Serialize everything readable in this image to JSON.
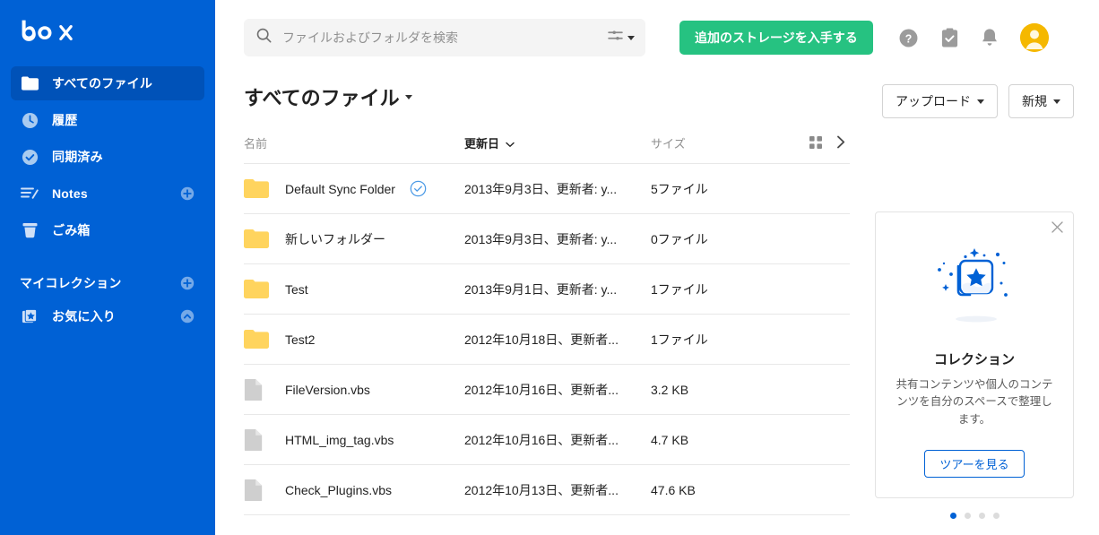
{
  "sidebar": {
    "logo_text": "box",
    "items": [
      {
        "label": "すべてのファイル",
        "icon": "folder-icon",
        "active": true
      },
      {
        "label": "履歴",
        "icon": "clock-icon",
        "active": false
      },
      {
        "label": "同期済み",
        "icon": "check-circle-icon",
        "active": false
      },
      {
        "label": "Notes",
        "icon": "notes-icon",
        "active": false,
        "trailing": "plus-icon"
      },
      {
        "label": "ごみ箱",
        "icon": "trash-icon",
        "active": false
      }
    ],
    "collections": {
      "header": "マイコレクション",
      "header_trailing": "plus-icon",
      "items": [
        {
          "label": "お気に入り",
          "icon": "favorites-star-icon",
          "trailing": "chevron-up-icon"
        }
      ]
    }
  },
  "topbar": {
    "search": {
      "placeholder": "ファイルおよびフォルダを検索",
      "value": "",
      "icon": "search-icon",
      "filter_icon": "filter-icon"
    },
    "cta_label": "追加のストレージを入手する",
    "icons": [
      {
        "name": "help-icon"
      },
      {
        "name": "tasks-clipboard-icon"
      },
      {
        "name": "notifications-bell-icon"
      }
    ],
    "avatar": {
      "name": "user-avatar",
      "color": "#f5b800"
    }
  },
  "buttons": {
    "upload_label": "アップロード",
    "new_label": "新規"
  },
  "main": {
    "page_title": "すべてのファイル",
    "columns": {
      "name": "名前",
      "date": "更新日",
      "size": "サイズ",
      "grid_icon": "grid-view-icon",
      "expand_icon": "chevron-right-icon"
    },
    "rows": [
      {
        "icon": "folder-icon",
        "name": "Default Sync Folder",
        "badge": "sync-check-icon",
        "date": "2013年9月3日、更新者: y...",
        "size": "5ファイル"
      },
      {
        "icon": "folder-icon",
        "name": "新しいフォルダー",
        "badge": null,
        "date": "2013年9月3日、更新者: y...",
        "size": "0ファイル"
      },
      {
        "icon": "folder-icon",
        "name": "Test",
        "badge": null,
        "date": "2013年9月1日、更新者: y...",
        "size": "1ファイル"
      },
      {
        "icon": "folder-icon",
        "name": "Test2",
        "badge": null,
        "date": "2012年10月18日、更新者...",
        "size": "1ファイル"
      },
      {
        "icon": "file-icon",
        "name": "FileVersion.vbs",
        "badge": null,
        "date": "2012年10月16日、更新者...",
        "size": "3.2 KB"
      },
      {
        "icon": "file-icon",
        "name": "HTML_img_tag.vbs",
        "badge": null,
        "date": "2012年10月16日、更新者...",
        "size": "4.7 KB"
      },
      {
        "icon": "file-icon",
        "name": "Check_Plugins.vbs",
        "badge": null,
        "date": "2012年10月13日、更新者...",
        "size": "47.6 KB"
      }
    ]
  },
  "promo": {
    "close_icon": "close-icon",
    "art_icon": "collections-star-illustration",
    "title": "コレクション",
    "body": "共有コンテンツや個人のコンテンツを自分のスペースで整理します。",
    "button_label": "ツアーを見る",
    "dots": 4,
    "active_dot": 0
  },
  "colors": {
    "brand_blue": "#0061d5",
    "sidebar_active": "#0052b8",
    "cta_green": "#26c281",
    "folder_yellow": "#ffd45e",
    "file_gray": "#cfcfcf"
  }
}
